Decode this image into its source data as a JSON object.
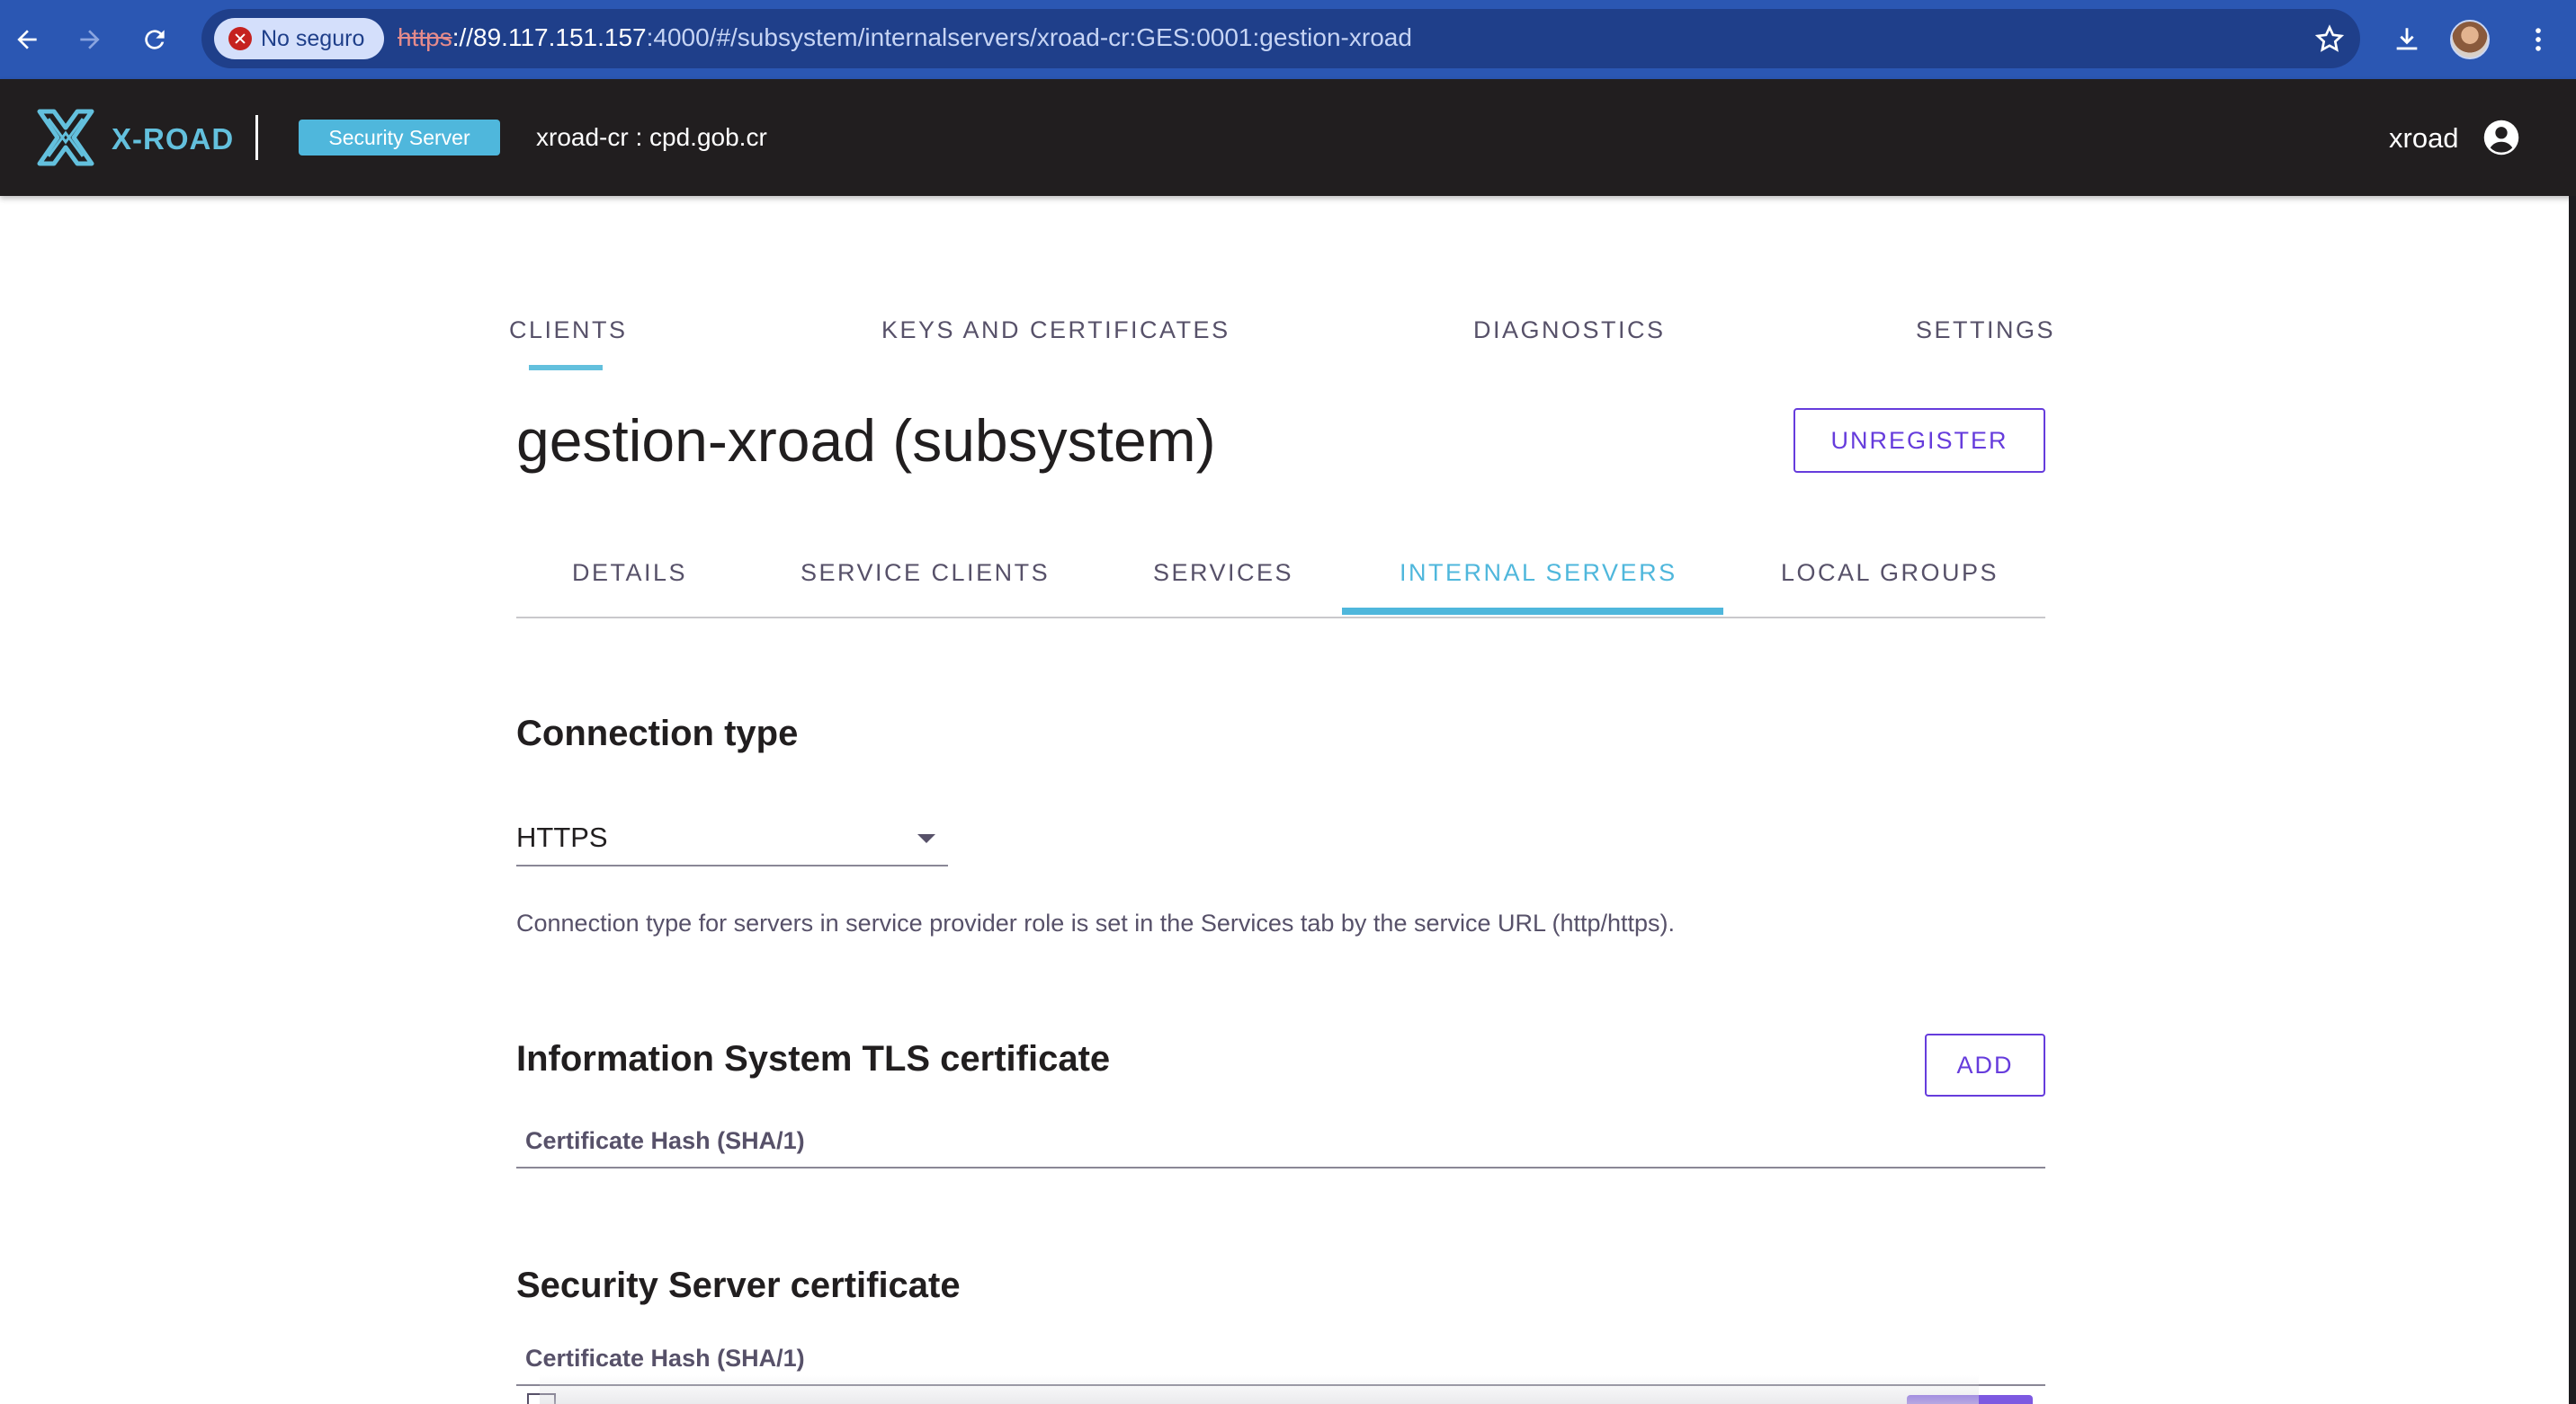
{
  "browser": {
    "security_chip": "No seguro",
    "url_scheme": "https",
    "url_host": "://89.117.151.157",
    "url_rest": ":4000/#/subsystem/internalservers/xroad-cr:GES:0001:gestion-xroad"
  },
  "header": {
    "logo_text": "X-ROAD",
    "badge": "Security Server",
    "instance": "xroad-cr : cpd.gob.cr",
    "user": "xroad",
    "colors": {
      "bar": "#211e1f",
      "accent": "#63c0dd"
    }
  },
  "main_tabs": [
    {
      "label": "CLIENTS",
      "active": true
    },
    {
      "label": "KEYS AND CERTIFICATES",
      "active": false
    },
    {
      "label": "DIAGNOSTICS",
      "active": false
    },
    {
      "label": "SETTINGS",
      "active": false
    }
  ],
  "page": {
    "title": "gestion-xroad (subsystem)",
    "unregister_label": "UNREGISTER"
  },
  "sub_tabs": [
    {
      "label": "DETAILS",
      "active": false
    },
    {
      "label": "SERVICE CLIENTS",
      "active": false
    },
    {
      "label": "SERVICES",
      "active": false
    },
    {
      "label": "INTERNAL SERVERS",
      "active": true
    },
    {
      "label": "LOCAL GROUPS",
      "active": false
    }
  ],
  "connection": {
    "title": "Connection type",
    "selected": "HTTPS",
    "hint": "Connection type for servers in service provider role is set in the Services tab by the service URL (http/https)."
  },
  "tls": {
    "title": "Information System TLS certificate",
    "add_label": "ADD",
    "column": "Certificate Hash (SHA/1)"
  },
  "ss_cert": {
    "title": "Security Server certificate",
    "column": "Certificate Hash (SHA/1)"
  },
  "icons": [
    "back-arrow-icon",
    "forward-arrow-icon",
    "reload-icon",
    "not-secure-icon",
    "star-icon",
    "download-icon",
    "profile-avatar",
    "more-vert-icon",
    "xroad-logo-icon",
    "account-circle-icon",
    "dropdown-caret-icon"
  ]
}
